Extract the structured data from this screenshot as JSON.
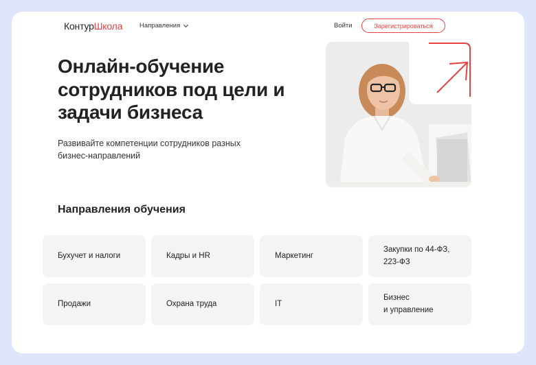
{
  "header": {
    "logo_part1": "Контур",
    "logo_part2": "Школа",
    "nav_directions": "Направления",
    "login": "Войти",
    "register": "Зарегистрироваться"
  },
  "hero": {
    "title": "Онлайн-обучение сотрудников под цели и задачи бизнеса",
    "subtitle": "Развивайте компетенции сотрудников разных бизнес-направлений"
  },
  "directions": {
    "title": "Направления обучения",
    "items": [
      {
        "label": "Бухучет и налоги"
      },
      {
        "label": "Кадры и HR"
      },
      {
        "label": "Маркетинг"
      },
      {
        "label": "Закупки по 44-ФЗ,\n223-ФЗ"
      },
      {
        "label": "Продажи"
      },
      {
        "label": "Охрана труда"
      },
      {
        "label": "IT"
      },
      {
        "label": "Бизнес\nи управление"
      }
    ]
  },
  "colors": {
    "accent": "#e8403e",
    "page_bg": "#dfe6fb",
    "tile_bg": "#f4f4f4"
  }
}
